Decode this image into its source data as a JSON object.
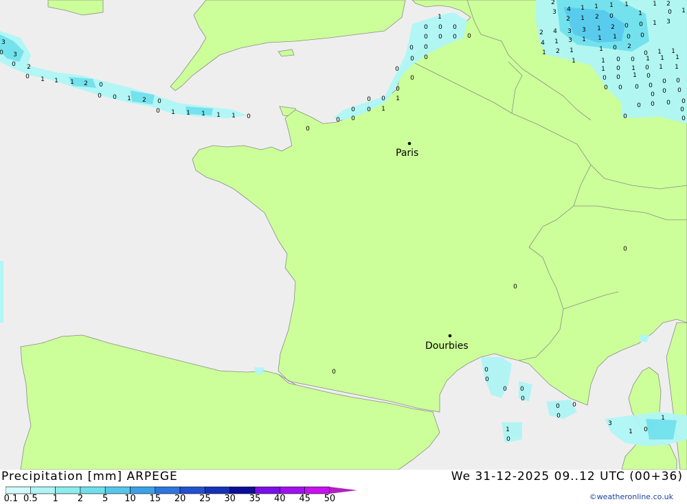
{
  "title": {
    "product": "Precipitation [mm] ARPEGE",
    "valid": "We 31-12-2025 09..12 UTC (00+36)"
  },
  "credit": "©weatheronline.co.uk",
  "legend": {
    "labels": [
      "0.1",
      "0.5",
      "1",
      "2",
      "5",
      "10",
      "15",
      "20",
      "25",
      "30",
      "35",
      "40",
      "45",
      "50"
    ],
    "colors": [
      "#d2fafa",
      "#aff5f5",
      "#8ceded",
      "#6ee0ec",
      "#55c8ec",
      "#3aa2e8",
      "#2d76e0",
      "#2250d0",
      "#1632b8",
      "#0c0c9a",
      "#7a10e8",
      "#a010f0",
      "#c810f0",
      "#e010e0",
      "#b020c0"
    ]
  },
  "colors": {
    "sea": "#eeeeee",
    "land": "#ccff99",
    "border": "#8a8a8a"
  },
  "cities": [
    {
      "name": "Paris"
    },
    {
      "name": "Dourbies"
    }
  ],
  "precip_labels": [
    "3",
    "0",
    "3",
    "0",
    "2",
    "0",
    "1",
    "1",
    "1",
    "2",
    "0",
    "0",
    "0",
    "1",
    "2",
    "0",
    "0",
    "1",
    "1",
    "1",
    "1",
    "1",
    "0",
    "0",
    "0",
    "0",
    "0",
    "0",
    "1",
    "0",
    "0",
    "1",
    "0",
    "0",
    "0",
    "0",
    "0",
    "0",
    "0",
    "0",
    "0",
    "0",
    "0",
    "0",
    "0",
    "0",
    "1",
    "2",
    "4",
    "1",
    "1",
    "1",
    "1",
    "1",
    "2",
    "3",
    "2",
    "1",
    "2",
    "0",
    "1",
    "0",
    "1",
    "2",
    "4",
    "3",
    "3",
    "1",
    "2",
    "0",
    "0",
    "1",
    "3",
    "4",
    "1",
    "3",
    "1",
    "1",
    "1",
    "0",
    "0",
    "1",
    "2",
    "1",
    "1",
    "0",
    "2",
    "0",
    "1",
    "1",
    "1",
    "1",
    "0",
    "0",
    "1",
    "1",
    "1",
    "1",
    "0",
    "1",
    "0",
    "1",
    "1",
    "0",
    "0",
    "1",
    "0",
    "0",
    "0",
    "0",
    "0",
    "0",
    "0",
    "0",
    "0",
    "0",
    "0",
    "0",
    "0",
    "0",
    "0",
    "0",
    "0",
    "0",
    "0",
    "0",
    "0",
    "0",
    "0",
    "0",
    "0",
    "0",
    "0",
    "0",
    "1",
    "0",
    "3",
    "1",
    "0",
    "1"
  ]
}
